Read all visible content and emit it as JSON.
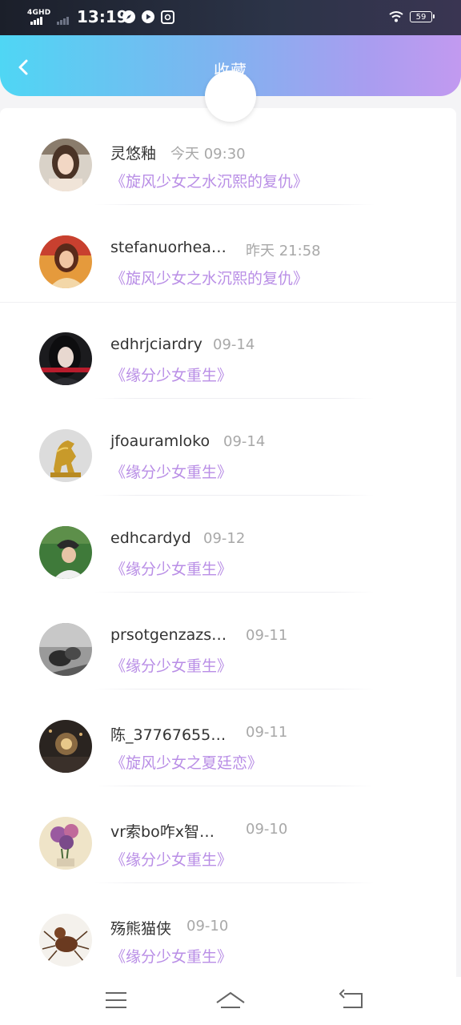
{
  "status_bar": {
    "network": "4GHD",
    "time": "13:19",
    "battery": "59"
  },
  "header": {
    "title": "收藏"
  },
  "items": [
    {
      "name": "灵悠釉",
      "time": "今天 09:30",
      "title": "《旋风少女之水沉熙的复仇》"
    },
    {
      "name": "stefanuorhea…",
      "time": "昨天 21:58",
      "title": "《旋风少女之水沉熙的复仇》"
    },
    {
      "name": "edhrjciardry",
      "time": "09-14",
      "title": "《缘分少女重生》"
    },
    {
      "name": "jfoauramloko",
      "time": "09-14",
      "title": "《缘分少女重生》"
    },
    {
      "name": "edhcardyd",
      "time": "09-12",
      "title": "《缘分少女重生》"
    },
    {
      "name": "prsotgenzazs…",
      "time": "09-11",
      "title": "《缘分少女重生》"
    },
    {
      "name": "陈_37767655…",
      "time": "09-11",
      "title": "《旋风少女之夏廷恋》"
    },
    {
      "name": "vr索bo咋x智…",
      "time": "09-10",
      "title": "《缘分少女重生》"
    },
    {
      "name": "殇熊猫侠",
      "time": "09-10",
      "title": "《缘分少女重生》"
    }
  ],
  "nav_bar": {
    "icons": [
      "menu-icon",
      "home-icon",
      "back-arrow-icon"
    ]
  }
}
